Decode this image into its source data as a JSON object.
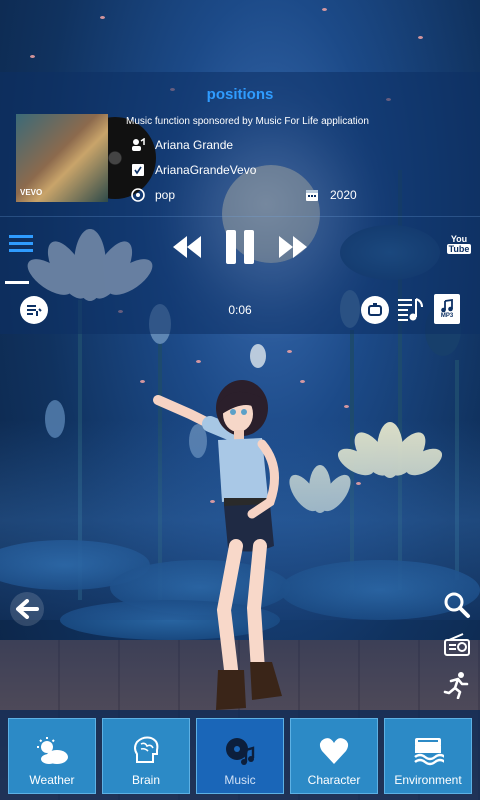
{
  "music": {
    "title": "positions",
    "sponsor": "Music function sponsored by Music For Life application",
    "album_label": "VEVO",
    "artist": "Ariana Grande",
    "channel": "ArianaGrandeVevo",
    "genre": "pop",
    "year": "2020",
    "elapsed": "0:06",
    "youtube_label_top": "You",
    "youtube_label_bottom": "Tube",
    "file_label": "MP3"
  },
  "nav": {
    "items": [
      {
        "label": "Weather",
        "icon": "weather-icon"
      },
      {
        "label": "Brain",
        "icon": "brain-icon"
      },
      {
        "label": "Music",
        "icon": "music-disc-icon"
      },
      {
        "label": "Character",
        "icon": "heart-icon"
      },
      {
        "label": "Environment",
        "icon": "environment-icon"
      }
    ],
    "active": "Music"
  },
  "colors": {
    "title": "#2f9cff",
    "nav_button": "#2c8ac6",
    "nav_active": "#1a66b8",
    "panel": "#0c3064"
  }
}
